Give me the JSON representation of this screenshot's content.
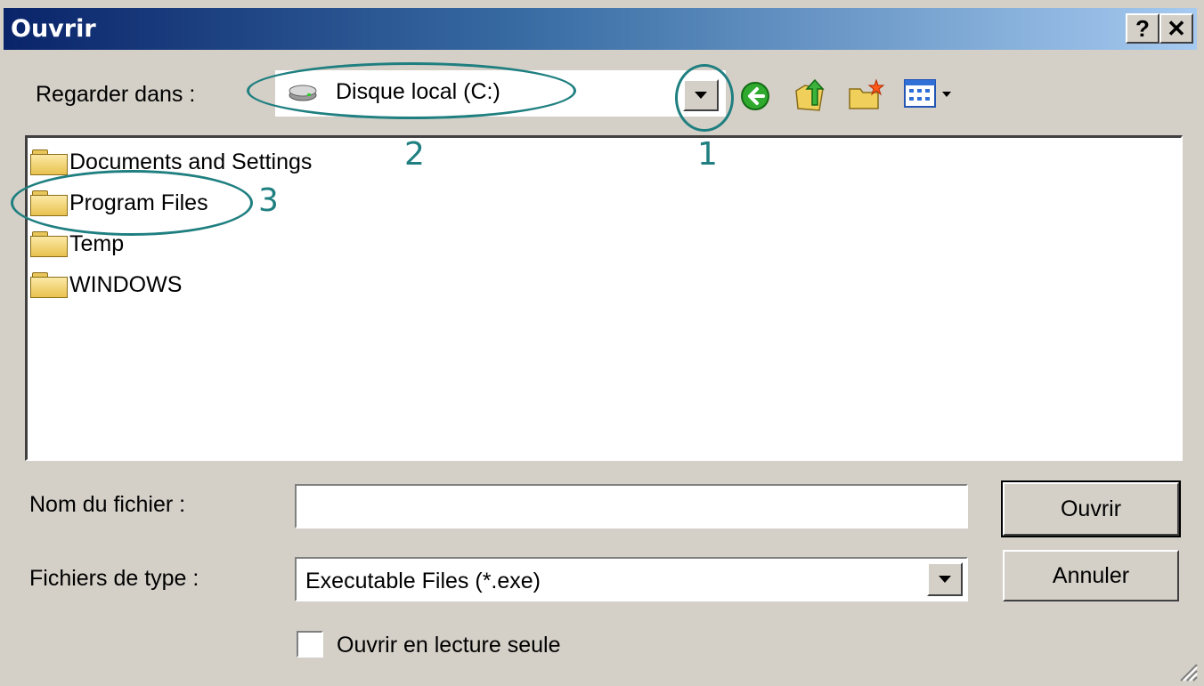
{
  "window": {
    "title": "Ouvrir",
    "help_label": "?",
    "close_label": "✕"
  },
  "look_in": {
    "label": "Regarder dans :",
    "value": "Disque local (C:)"
  },
  "files": [
    {
      "name": "Documents and Settings",
      "icon": "folder-icon"
    },
    {
      "name": "Program Files",
      "icon": "folder-icon"
    },
    {
      "name": "Temp",
      "icon": "folder-icon"
    },
    {
      "name": "WINDOWS",
      "icon": "folder-icon"
    }
  ],
  "filename": {
    "label": "Nom du fichier :",
    "value": ""
  },
  "filetype": {
    "label": "Fichiers de type :",
    "value": "Executable Files (*.exe)"
  },
  "buttons": {
    "open": "Ouvrir",
    "cancel": "Annuler"
  },
  "readonly_checkbox": {
    "label": "Ouvrir en lecture seule",
    "checked": false
  },
  "annotations": [
    "1",
    "2",
    "3"
  ],
  "colors": {
    "annotation": "#1f7f80",
    "title_start": "#0a246a",
    "title_end": "#a6caf0",
    "dialog_bg": "#d4d0c8"
  }
}
